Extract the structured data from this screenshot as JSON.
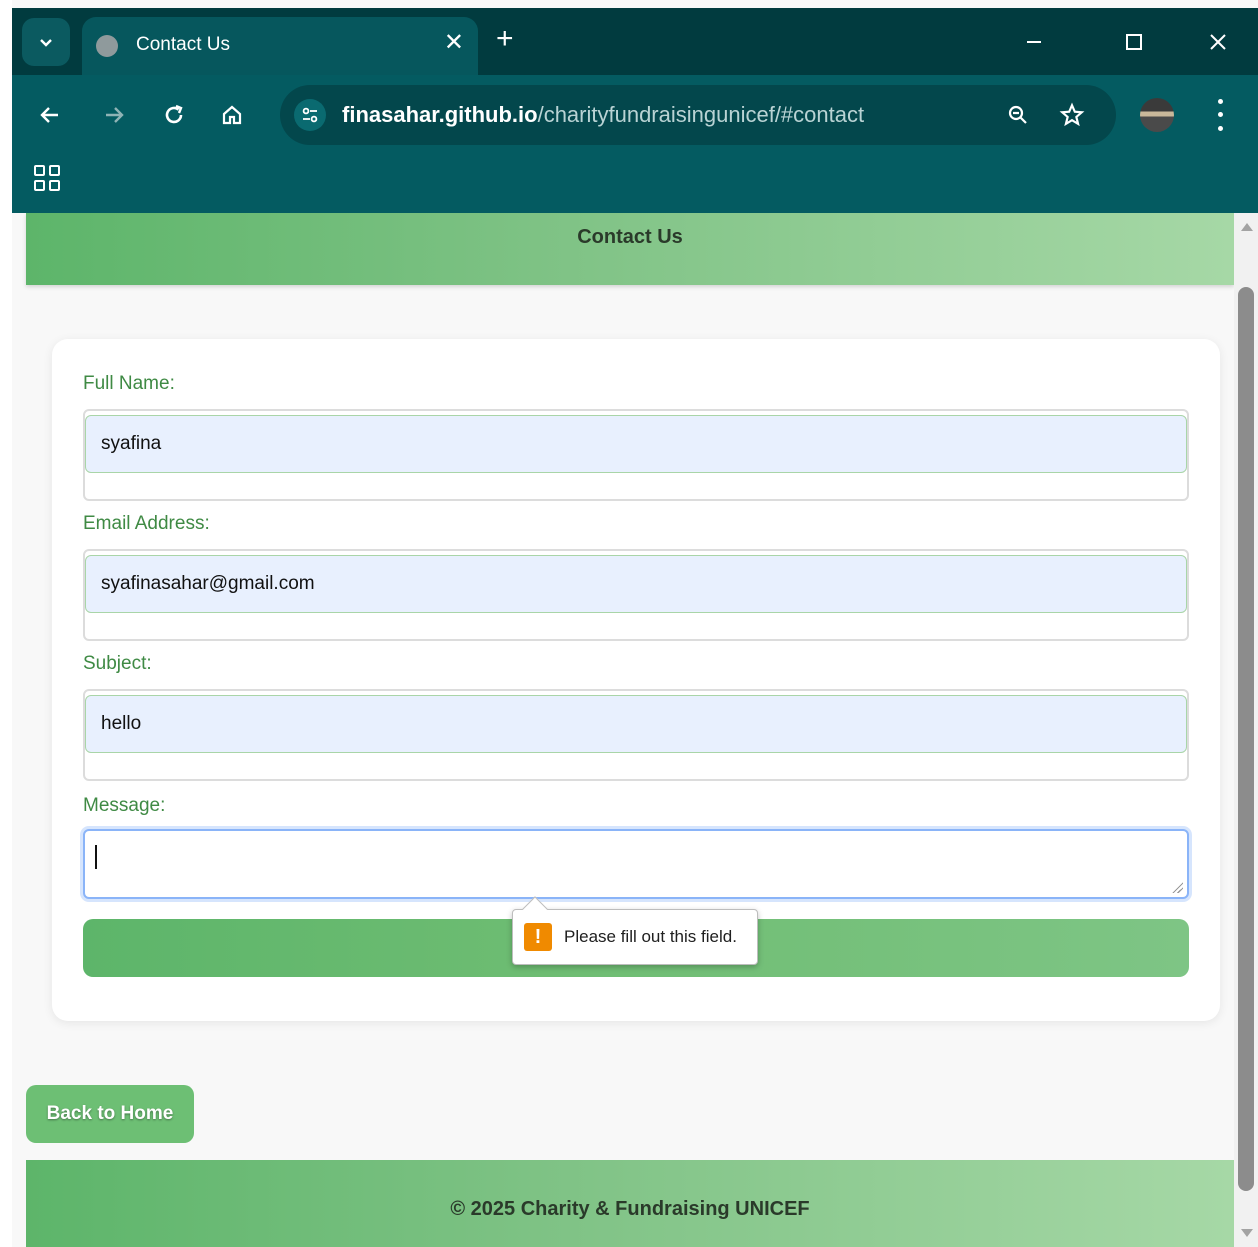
{
  "browser": {
    "tab_title": "Contact Us",
    "url_host": "finasahar.github.io",
    "url_path": "/charityfundraisingunicef/#contact"
  },
  "page": {
    "header_title": "Contact Us",
    "form": {
      "full_name_label": "Full Name:",
      "full_name_value": "syafina",
      "email_label": "Email Address:",
      "email_value": "syafinasahar@gmail.com",
      "subject_label": "Subject:",
      "subject_value": "hello",
      "message_label": "Message:",
      "message_value": ""
    },
    "validation_tooltip": "Please fill out this field.",
    "back_button": "Back to Home",
    "footer_text": "© 2025 Charity & Fundraising UNICEF"
  },
  "colors": {
    "tab_strip": "#013b3f",
    "toolbar": "#045b61",
    "accent_green": "#5db56a",
    "label_green": "#3f8a44",
    "autofill_blue": "#e8f0fe"
  },
  "icons": [
    "tab-search-icon",
    "globe-icon",
    "close-icon",
    "plus-icon",
    "minimize-icon",
    "maximize-icon",
    "back-arrow-icon",
    "forward-arrow-icon",
    "reload-icon",
    "home-icon",
    "site-settings-icon",
    "zoom-icon",
    "star-icon",
    "profile-avatar",
    "menu-icon",
    "apps-icon",
    "warning-icon"
  ]
}
